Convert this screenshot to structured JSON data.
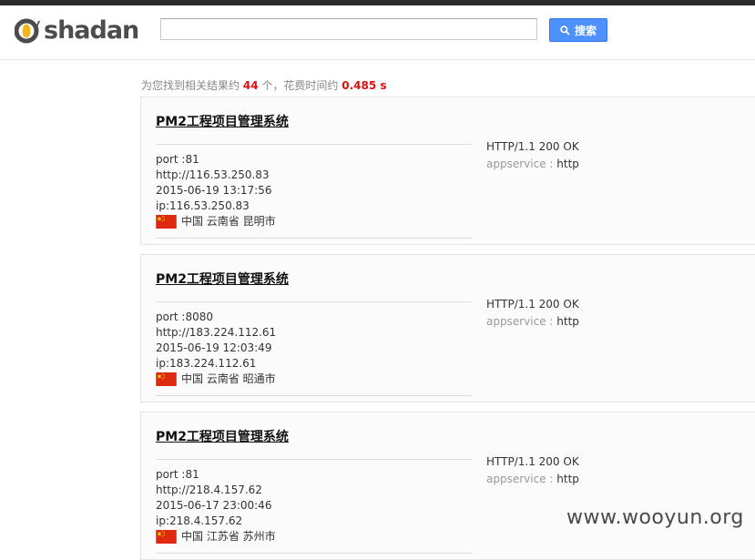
{
  "brand": {
    "logo_text": "shadan",
    "logo_mark": "O'"
  },
  "search": {
    "value": "",
    "placeholder": "",
    "button_label": "搜索",
    "button_icon": "search-icon"
  },
  "summary": {
    "prefix": "为您找到相关结果约",
    "count": "44",
    "middle": "个，花费时间约",
    "time": "0.485 s"
  },
  "results": [
    {
      "title": "PM2工程项目管理系统",
      "port": "port :81",
      "http": "http://116.53.250.83",
      "date": "2015-06-19 13:17:56",
      "ip": "ip:116.53.250.83",
      "location": "中国 云南省 昆明市",
      "status": "HTTP/1.1 200 OK",
      "service_label": "appservice :",
      "service_value": "http"
    },
    {
      "title": "PM2工程项目管理系统",
      "port": "port :8080",
      "http": "http://183.224.112.61",
      "date": "2015-06-19 12:03:49",
      "ip": "ip:183.224.112.61",
      "location": "中国 云南省 昭通市",
      "status": "HTTP/1.1 200 OK",
      "service_label": "appservice :",
      "service_value": "http"
    },
    {
      "title": "PM2工程项目管理系统",
      "port": "port :81",
      "http": "http://218.4.157.62",
      "date": "2015-06-17 23:00:46",
      "ip": "ip:218.4.157.62",
      "location": "中国 江苏省 苏州市",
      "status": "HTTP/1.1 200 OK",
      "service_label": "appservice :",
      "service_value": "http"
    }
  ],
  "watermark": "www.wooyun.org",
  "colors": {
    "accent_button": "#4d90fe",
    "highlight": "#dd1111",
    "flag_red": "#de2910",
    "flag_star": "#ffde00"
  }
}
